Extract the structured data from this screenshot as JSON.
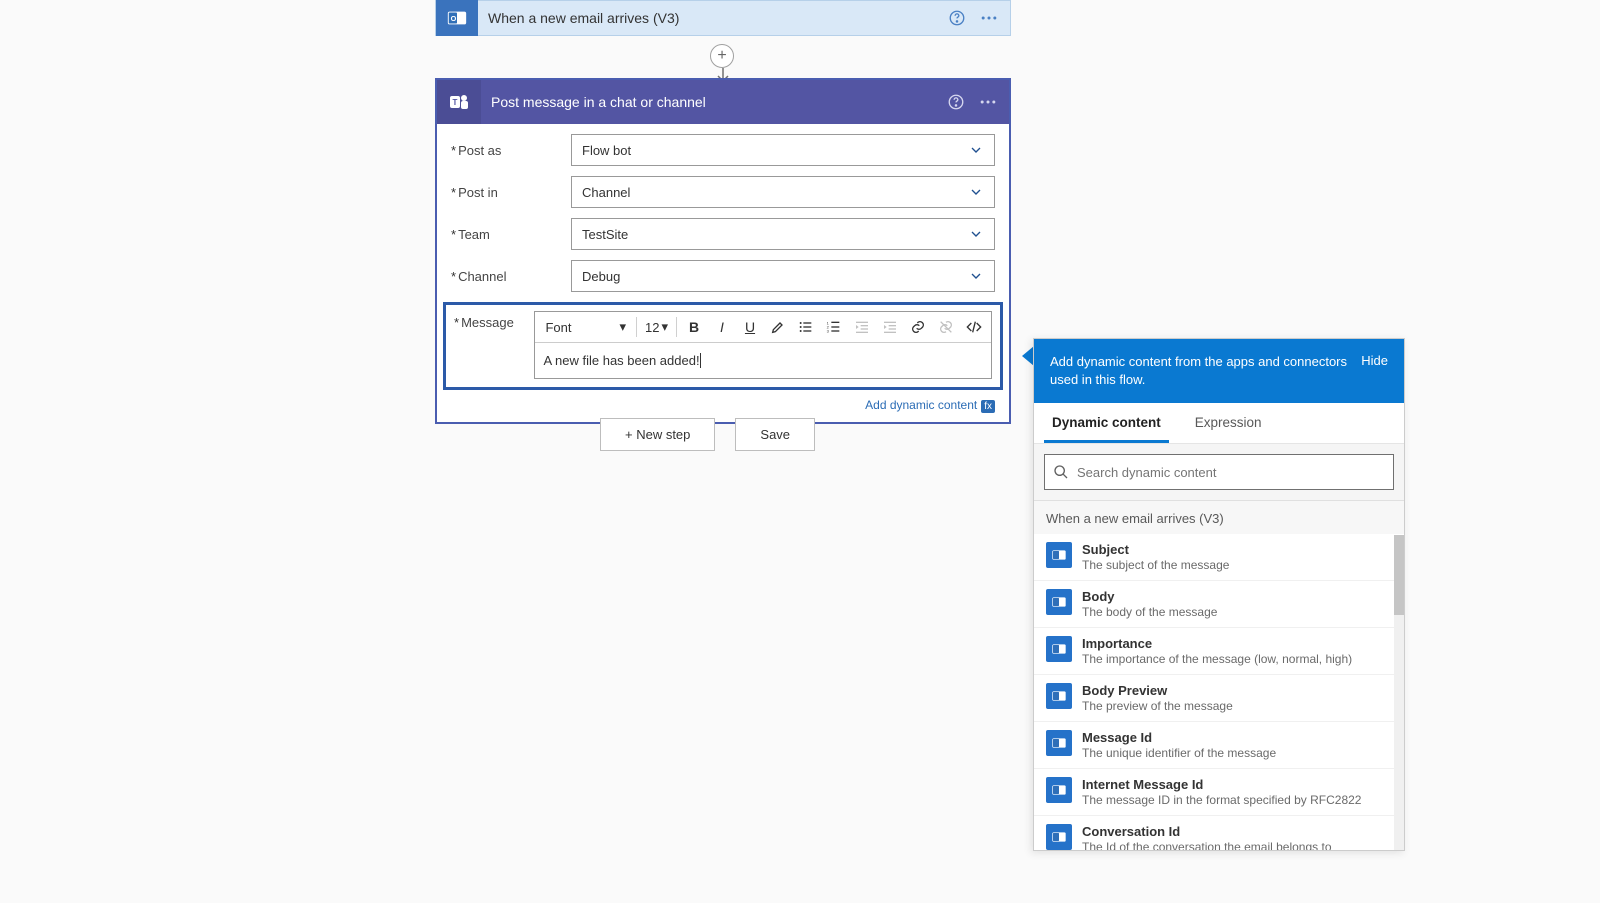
{
  "trigger": {
    "title": "When a new email arrives (V3)"
  },
  "action": {
    "title": "Post message in a chat or channel",
    "fields": {
      "post_as": {
        "label": "Post as",
        "value": "Flow bot"
      },
      "post_in": {
        "label": "Post in",
        "value": "Channel"
      },
      "team": {
        "label": "Team",
        "value": "TestSite"
      },
      "channel": {
        "label": "Channel",
        "value": "Debug"
      },
      "message_label": "Message",
      "message_value": "A new file has been added!"
    },
    "editor": {
      "font_label": "Font",
      "size_label": "12"
    },
    "add_dynamic_link": "Add dynamic content"
  },
  "buttons": {
    "new_step": "+ New step",
    "save": "Save"
  },
  "dynamic_panel": {
    "header": "Add dynamic content from the apps and connectors used in this flow.",
    "hide_label": "Hide",
    "tabs": {
      "dynamic": "Dynamic content",
      "expression": "Expression"
    },
    "search_placeholder": "Search dynamic content",
    "group_title": "When a new email arrives (V3)",
    "items": [
      {
        "name": "Subject",
        "desc": "The subject of the message"
      },
      {
        "name": "Body",
        "desc": "The body of the message"
      },
      {
        "name": "Importance",
        "desc": "The importance of the message (low, normal, high)"
      },
      {
        "name": "Body Preview",
        "desc": "The preview of the message"
      },
      {
        "name": "Message Id",
        "desc": "The unique identifier of the message"
      },
      {
        "name": "Internet Message Id",
        "desc": "The message ID in the format specified by RFC2822"
      },
      {
        "name": "Conversation Id",
        "desc": "The Id of the conversation the email belongs to"
      }
    ]
  }
}
